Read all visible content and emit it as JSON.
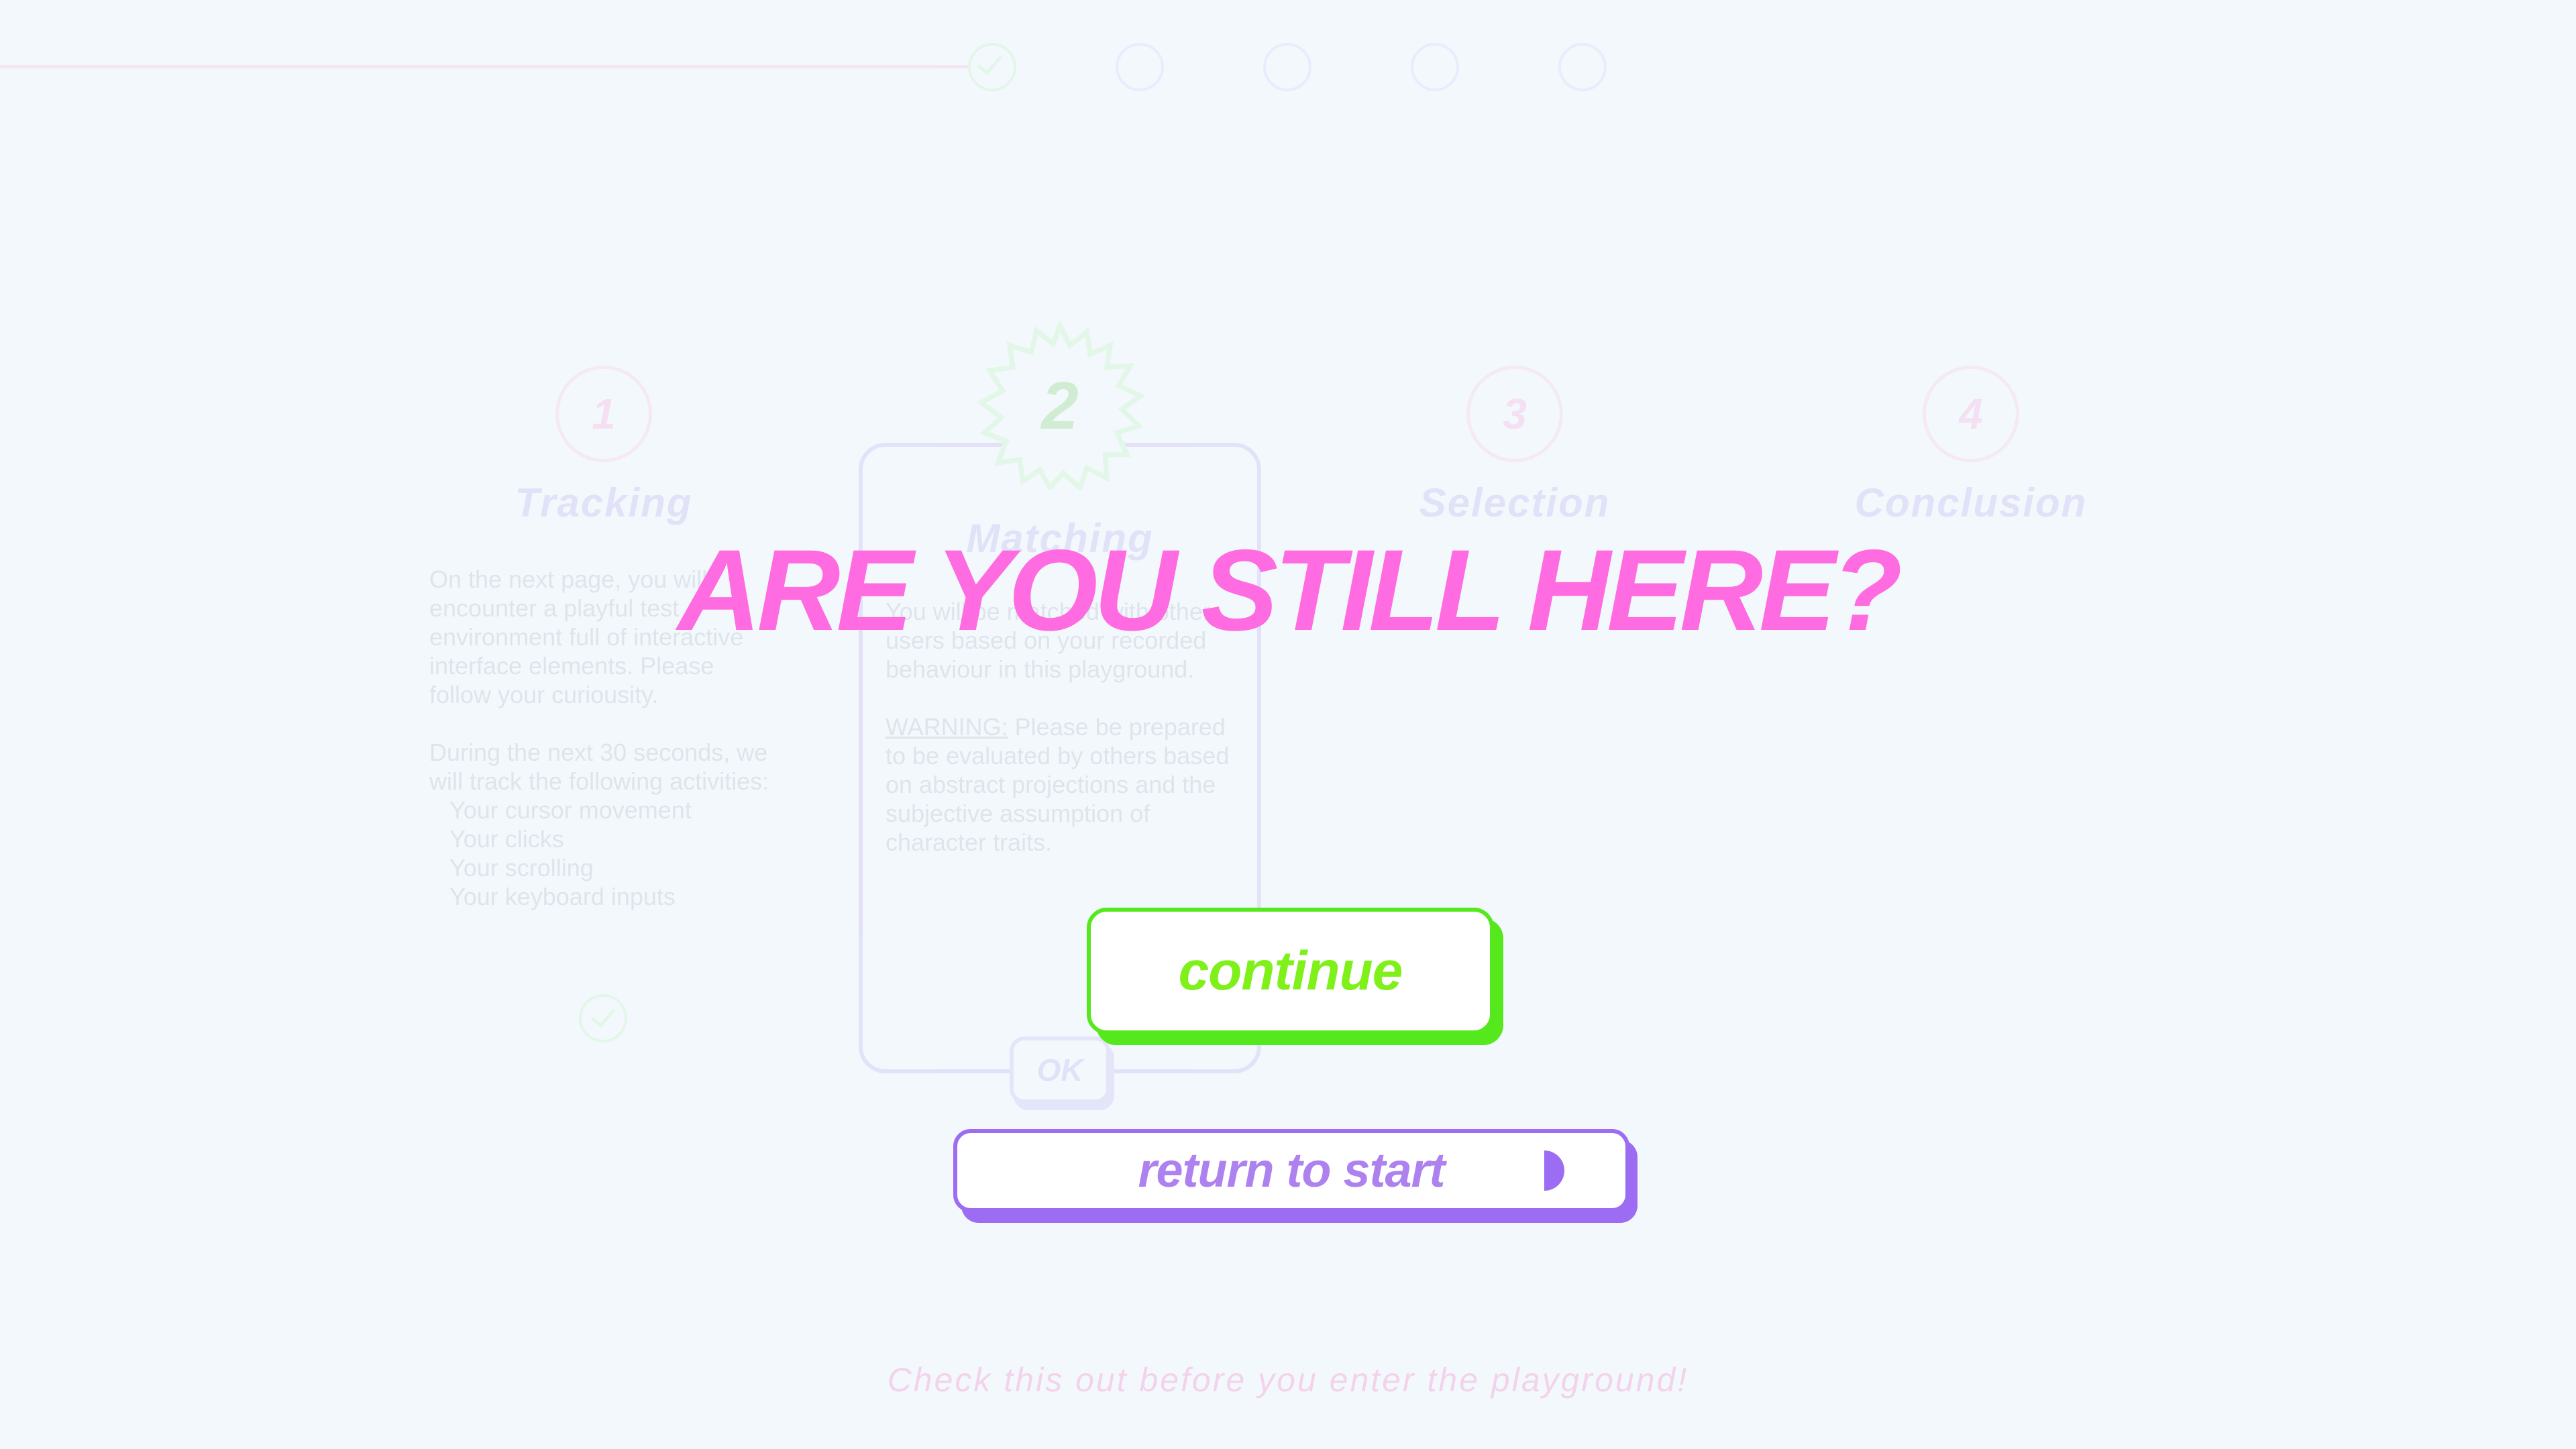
{
  "progress": {
    "steps": [
      {
        "state": "done"
      },
      {
        "state": "pending"
      },
      {
        "state": "pending"
      },
      {
        "state": "pending"
      },
      {
        "state": "pending"
      }
    ]
  },
  "steps": [
    {
      "number": "1",
      "title": "Tracking",
      "paragraphs": [
        "On the next page, you will encounter a playful test environment full of interactive interface elements. Please follow your curiousity.",
        "During the next 30 seconds, we will track the following activities:"
      ],
      "list": [
        "Your cursor movement",
        "Your clicks",
        "Your scrolling",
        "Your keyboard inputs"
      ]
    },
    {
      "number": "2",
      "title": "Matching",
      "paragraphs": [
        "You will be matched with other users based on your recorded behaviour in this playground."
      ],
      "warning_label": "WARNING:",
      "warning_text": "Please be prepared to be evaluated by others based on abstract projections and the subjective assumption of character traits.",
      "ok_label": "OK"
    },
    {
      "number": "3",
      "title": "Selection"
    },
    {
      "number": "4",
      "title": "Conclusion"
    }
  ],
  "footer": "Check this out before you enter the playground!",
  "modal": {
    "headline": "ARE YOU STILL HERE?",
    "continue_label": "continue",
    "return_label": "return to start"
  },
  "colors": {
    "headline": "#ff6be0",
    "continue_border": "#55e81c",
    "continue_text": "#7ff01a",
    "return_border": "#9c6df2",
    "return_text": "#ad82ee",
    "background": "#f3f8fd"
  }
}
